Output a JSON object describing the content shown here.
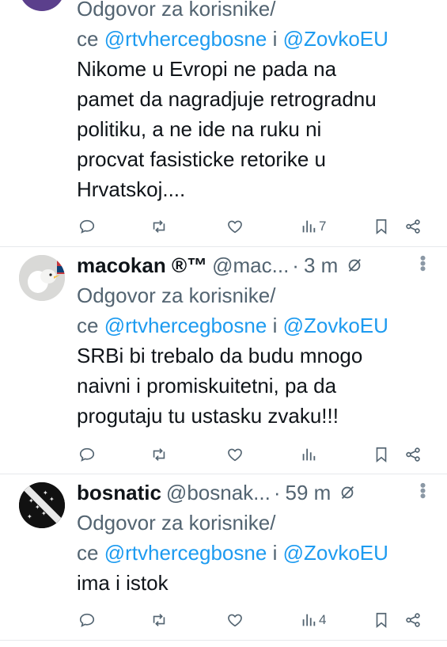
{
  "tweets": [
    {
      "replying_label": "Odgovor za korisnike/",
      "replying_prefix": "ce",
      "mention1": "@rtvhercegbosne",
      "joiner": "i",
      "mention2": "@ZovkoEU",
      "text_lines": [
        "Nikome u Evropi ne pada na",
        "pamet da nagradjuje retrogradnu",
        "politiku, a ne ide na ruku ni",
        "procvat fasisticke retorike u",
        "Hrvatskoj...."
      ],
      "views": "7"
    },
    {
      "name": "macokan ®™",
      "handle": "@mac...",
      "separator": "·",
      "time": "3 m",
      "replying_label": "Odgovor za korisnike/",
      "replying_prefix": "ce",
      "mention1": "@rtvhercegbosne",
      "joiner": "i",
      "mention2": "@ZovkoEU",
      "text_lines": [
        "SRBi bi trebalo da budu mnogo",
        "naivni i promiskuitetni, pa da",
        "progutaju tu ustasku zvaku!!!"
      ],
      "views": ""
    },
    {
      "name": "bosnatic",
      "handle": "@bosnak...",
      "separator": "·",
      "time": "59 m",
      "replying_label": "Odgovor za korisnike/",
      "replying_prefix": "ce",
      "mention1": "@rtvhercegbosne",
      "joiner": "i",
      "mention2": "@ZovkoEU",
      "text_lines": [
        "ima i istok"
      ],
      "views": "4"
    }
  ],
  "icons": [
    "reply-icon",
    "retweet-icon",
    "like-icon",
    "views-icon",
    "bookmark-icon",
    "share-icon",
    "grok-icon",
    "more-icon"
  ],
  "colors": {
    "link": "#1d9bf0",
    "secondary": "#536471",
    "text": "#0f1419"
  }
}
